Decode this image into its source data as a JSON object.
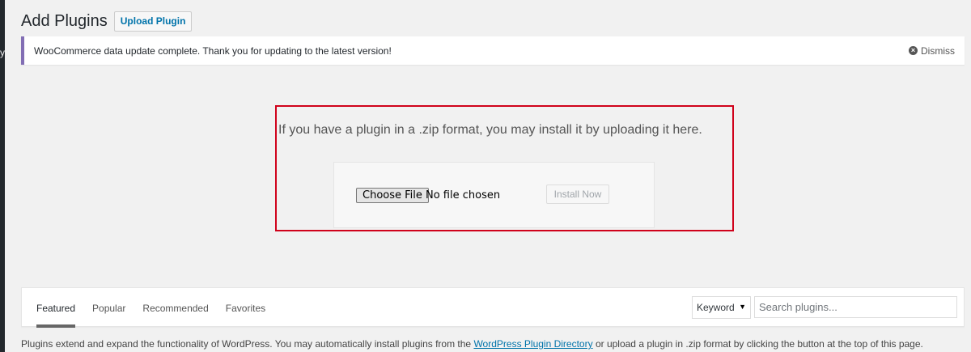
{
  "edge_glyph": "y",
  "header": {
    "title": "Add Plugins",
    "upload_button": "Upload Plugin"
  },
  "notice": {
    "message": "WooCommerce data update complete. Thank you for updating to the latest version!",
    "dismiss_label": "Dismiss",
    "dismiss_icon": "×",
    "accent_color": "#826eb4"
  },
  "upload": {
    "description": "If you have a plugin in a .zip format, you may install it by uploading it here.",
    "choose_file_label": "Choose File",
    "file_status": "No file chosen",
    "install_button": "Install Now",
    "highlight_color": "#d0021b"
  },
  "filter": {
    "tabs": [
      {
        "label": "Featured",
        "current": true
      },
      {
        "label": "Popular",
        "current": false
      },
      {
        "label": "Recommended",
        "current": false
      },
      {
        "label": "Favorites",
        "current": false
      }
    ],
    "search_type": "Keyword",
    "search_placeholder": "Search plugins..."
  },
  "footer": {
    "text_before": "Plugins extend and expand the functionality of WordPress. You may automatically install plugins from the ",
    "link_text": "WordPress Plugin Directory",
    "text_after": " or upload a plugin in .zip format by clicking the button at the top of this page."
  }
}
